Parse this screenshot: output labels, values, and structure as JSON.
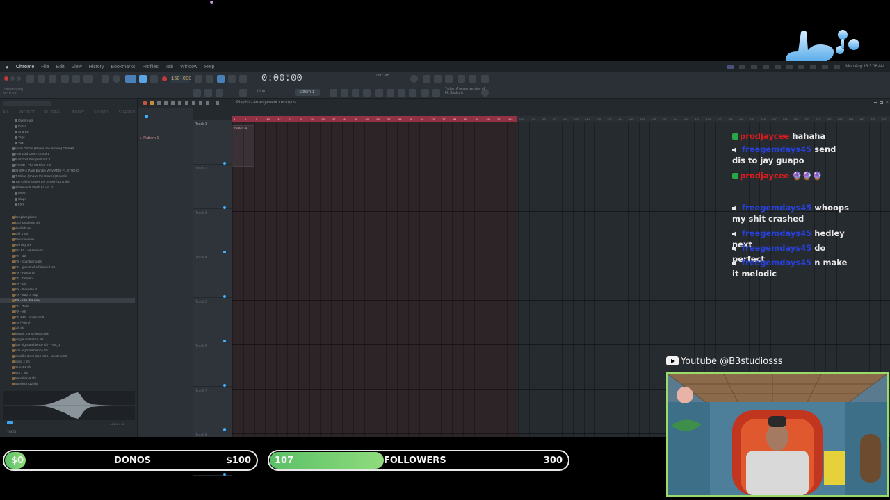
{
  "menubar": {
    "items": [
      "Chrome",
      "File",
      "Edit",
      "View",
      "History",
      "Bookmarks",
      "Profiles",
      "Tab",
      "Window",
      "Help"
    ],
    "clock": "Mon Aug 18  3:06 AM"
  },
  "toolbar": {
    "tempo": "150.000",
    "time": "0:00:00",
    "time_unit": "M:S:CS",
    "cpu": "2397 MB",
    "project_name": "[TheMontals]",
    "project_time": "39:07:19",
    "pattern": "Pattern 1",
    "snap": "Line",
    "news": "Today: A newer version of FL Studio is"
  },
  "browser": {
    "tabs": [
      "ALL",
      "PROJECT",
      "PLUGINS",
      "LIBRARY",
      "SOUNDS",
      "STARRED"
    ],
    "items": [
      "Open Hats",
      "Percs",
      "Snares",
      "Tags",
      "Vox",
      "Quay Global (Shows the Screen) Drumkit",
      "Ramzoid Drum Kit Vol.1",
      "Ramzoid Sample Pack 4",
      "RXKID - The 80 Files 2.0",
      "SHER-3 Pack Bundle WAV-MIDI-FL STUDIO",
      "T Minus (Shows the Screen) Drumkit",
      "Tay Keith (Shows the Screen) Drumkit",
      "whatever!5 Stash Kit vol. 2",
      "808's",
      "Claps",
      "FX's",
      "beepbeepbeep",
      "bird ambience sfx",
      "devilish sfx",
      "drill 3 sfx",
      "Electrowaves",
      "evil day sfx",
      "Fla FX - whatever!5",
      "FX - 12",
      "FX - country roads",
      "FX - guess who followed me",
      "FX - Pardon II",
      "FX - Pardon",
      "FX - pie",
      "FX - Reverse II",
      "FX - trap or trap",
      "FX - use this now",
      "FX - TVS",
      "FX - wif",
      "FX 140 - whatever!5",
      "FX [ Alert ]",
      "idk sfx",
      "instant transmission sfx",
      "jungle ambience sfx",
      "late night ambience sfx - Part_1",
      "late night ambience sfx",
      "metallic drum loop intro - whatever!5",
      "moto x sfx",
      "select 1 sfx",
      "skit 1 sfx",
      "transition 1 sfx",
      "transition 12 sfx"
    ],
    "selected_index": 31,
    "wave_meta": "44.1 kHz 32",
    "tags_label": "TAGS"
  },
  "playlist": {
    "title": "Playlist - Arrangement  ›  octopus",
    "pattern_item": "Pattern 1",
    "tracks": [
      "Track 1",
      "Track 2",
      "Track 3",
      "Track 4",
      "Track 5",
      "Track 6",
      "Track 7",
      "Track 8"
    ],
    "clip_label": "Pattern 1",
    "ruler": [
      "1",
      "5",
      "9",
      "13",
      "17",
      "21",
      "25",
      "29",
      "33",
      "37",
      "41",
      "45",
      "49",
      "53",
      "57",
      "61",
      "65",
      "69",
      "73",
      "77",
      "81",
      "85",
      "89",
      "93",
      "97",
      "101",
      "105",
      "109",
      "113",
      "117",
      "121",
      "125",
      "129",
      "133",
      "137",
      "141",
      "145",
      "149",
      "153",
      "157",
      "161",
      "165",
      "169",
      "173",
      "177",
      "181",
      "185",
      "189",
      "193",
      "197",
      "201",
      "205",
      "209",
      "213",
      "217",
      "221",
      "225",
      "229",
      "233",
      "237"
    ]
  },
  "chat": {
    "messages": [
      {
        "user": "prodjaycee",
        "user_color": "#e01b1b",
        "badge": true,
        "text": "hahaha"
      },
      {
        "user": "freegemdays45",
        "user_color": "#2740d8",
        "badge": false,
        "text": "send dis to jay guapo"
      },
      {
        "user": "prodjaycee",
        "user_color": "#e01b1b",
        "badge": true,
        "text": "🔮🔮🔮"
      },
      {
        "user": "freegemdays45",
        "user_color": "#2740d8",
        "badge": false,
        "text": "whoops my shit crashed"
      },
      {
        "user": "freegemdays45",
        "user_color": "#2740d8",
        "badge": false,
        "text": "hedley next"
      },
      {
        "user": "freegemdays45",
        "user_color": "#2740d8",
        "badge": false,
        "text": "do perfect"
      },
      {
        "user": "freegemdays45",
        "user_color": "#2740d8",
        "badge": false,
        "text": "n make it melodic"
      }
    ]
  },
  "social": {
    "youtube_handle": "Youtube @B3studiosss"
  },
  "donos": {
    "current": "$0",
    "label": "DONOS",
    "goal": "$100",
    "progress": 0.0
  },
  "followers": {
    "current": "107",
    "label": "FOLLOWERS",
    "goal": "300",
    "progress": 0.357
  },
  "colors": {
    "accent_green": "#5bc067",
    "cam_border": "#9bdb6a",
    "loop_red": "#b5324a",
    "logo_blue": "#7fc4f5"
  }
}
